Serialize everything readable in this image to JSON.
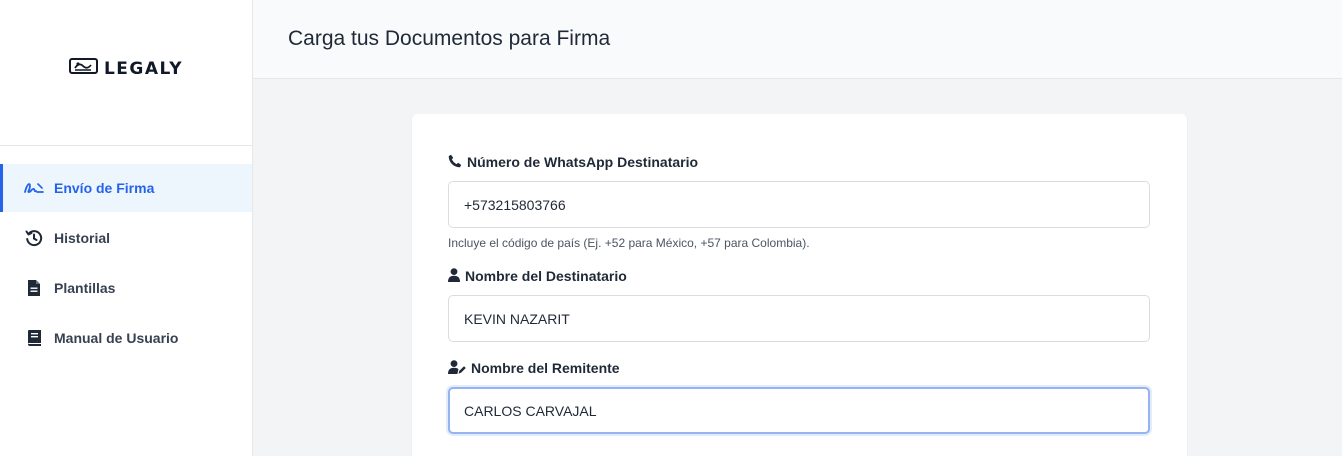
{
  "brand": {
    "name": "LEGALY"
  },
  "sidebar": {
    "items": [
      {
        "label": "Envío de Firma",
        "icon": "signature-icon",
        "active": true
      },
      {
        "label": "Historial",
        "icon": "history-icon",
        "active": false
      },
      {
        "label": "Plantillas",
        "icon": "file-icon",
        "active": false
      },
      {
        "label": "Manual de Usuario",
        "icon": "book-icon",
        "active": false
      }
    ]
  },
  "header": {
    "title": "Carga tus Documentos para Firma"
  },
  "form": {
    "whatsapp": {
      "label": "Número de WhatsApp Destinatario",
      "value": "+573215803766",
      "help": "Incluye el código de país (Ej. +52 para México, +57 para Colombia)."
    },
    "recipient": {
      "label": "Nombre del Destinatario",
      "value": "KEVIN NAZARIT"
    },
    "sender": {
      "label": "Nombre del Remitente",
      "value": "CARLOS CARVAJAL"
    }
  },
  "colors": {
    "accent": "#2563eb",
    "active_bg": "#eef6fd",
    "focus_border": "#93b4f0"
  }
}
